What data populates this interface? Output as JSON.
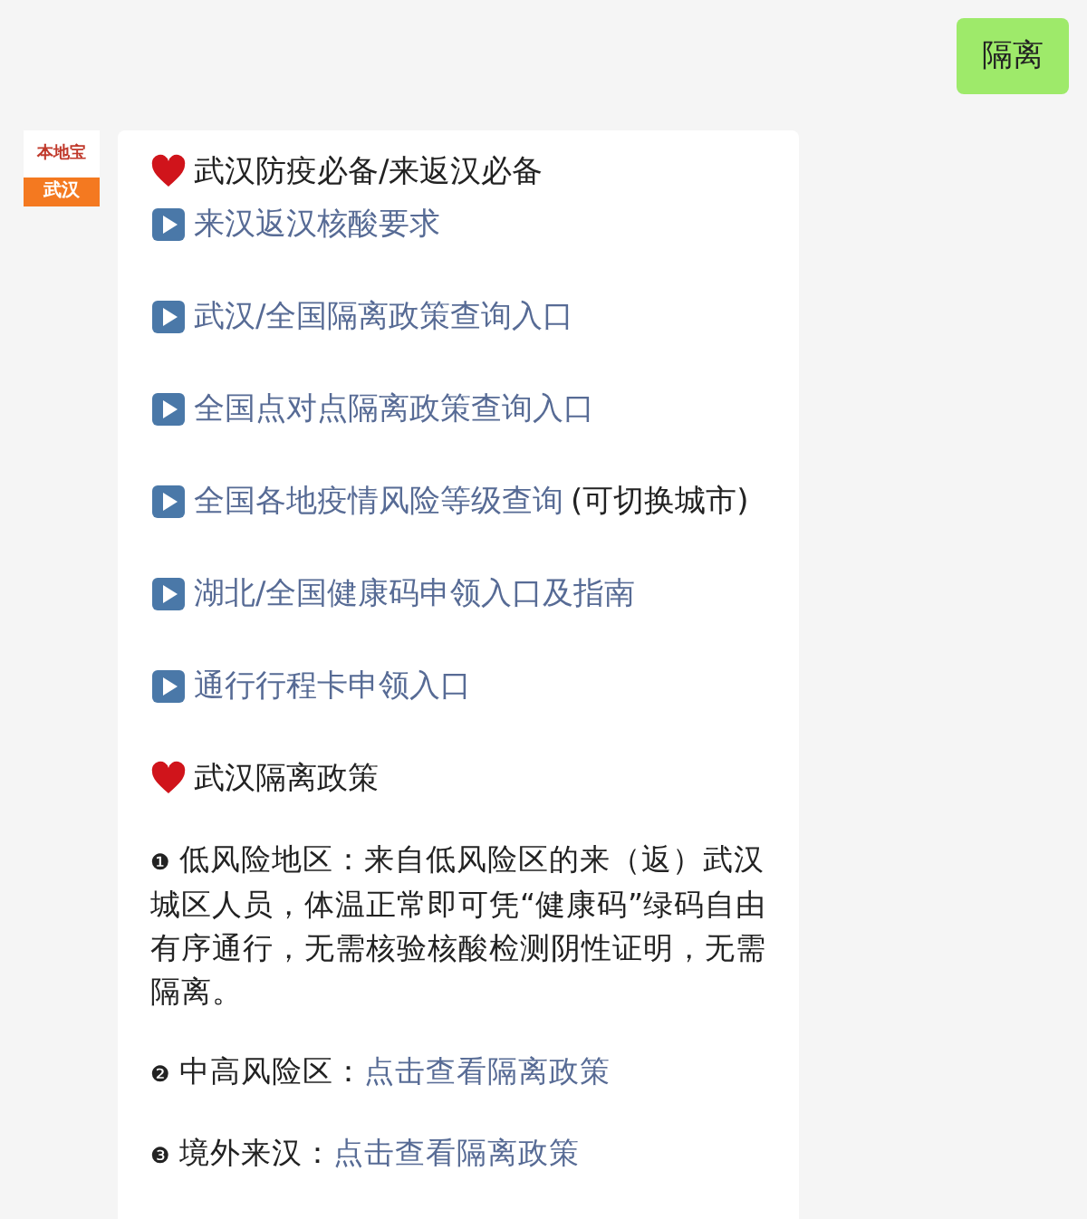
{
  "sent_message": {
    "text": "隔离"
  },
  "sender_avatar": {
    "brand": "本地宝",
    "city": "武汉"
  },
  "message": {
    "blocks": [
      {
        "kind": "heading",
        "text": "武汉防疫必备/来返汉必备"
      },
      {
        "kind": "link",
        "text": "来汉返汉核酸要求"
      },
      {
        "kind": "link",
        "text": "武汉/全国隔离政策查询入口"
      },
      {
        "kind": "link",
        "text": "全国点对点隔离政策查询入口"
      },
      {
        "kind": "link",
        "text": "全国各地疫情风险等级查询",
        "suffix": "(可切换城市)"
      },
      {
        "kind": "link",
        "text": "湖北/全国健康码申领入口及指南"
      },
      {
        "kind": "link",
        "text": "通行行程卡申领入口"
      },
      {
        "kind": "heading",
        "text": "武汉隔离政策"
      },
      {
        "kind": "numbered",
        "marker": "❶",
        "text": "低风险地区：来自低风险区的来（返）武汉城区人员，体温正常即可凭“健康码”绿码自由有序通行，无需核验核酸检测阴性证明，无需隔离。"
      },
      {
        "kind": "numbered",
        "marker": "❷",
        "text": "中高风险区：",
        "link": "点击查看隔离政策"
      },
      {
        "kind": "numbered",
        "marker": "❸",
        "text": "境外来汉：",
        "link": "点击查看隔离政策"
      }
    ]
  }
}
